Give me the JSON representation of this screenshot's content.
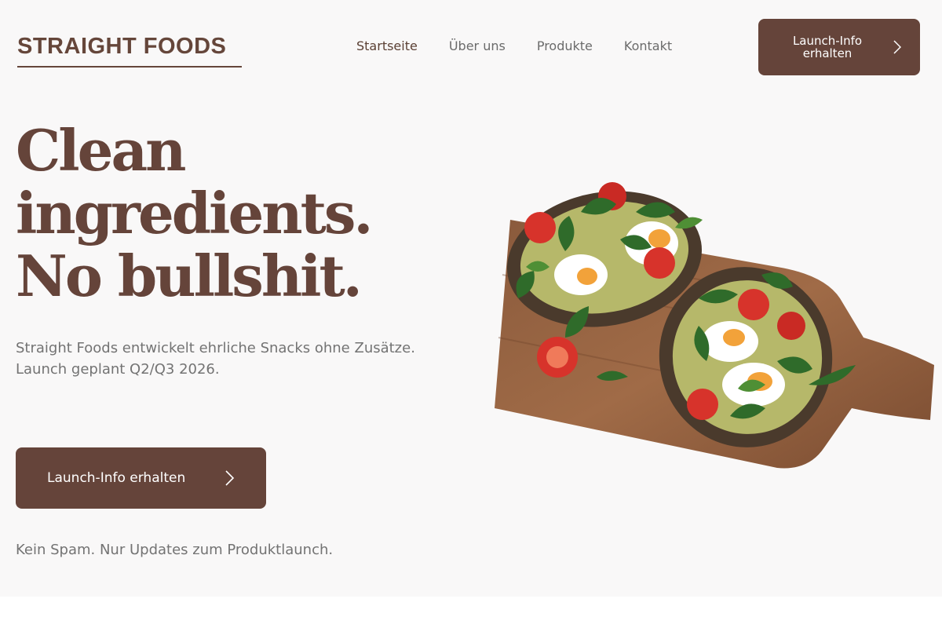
{
  "brand": {
    "name": "STRAIGHT FOODS"
  },
  "nav": {
    "items": [
      {
        "label": "Startseite",
        "active": true
      },
      {
        "label": "Über uns",
        "active": false
      },
      {
        "label": "Produkte",
        "active": false
      },
      {
        "label": "Kontakt",
        "active": false
      }
    ]
  },
  "header": {
    "cta": {
      "line1": "Launch-Info",
      "line2": "erhalten",
      "icon": "chevron-right-icon"
    }
  },
  "hero": {
    "headline": [
      "Clean",
      "ingredients.",
      "No bullshit."
    ],
    "subtext": [
      "Straight Foods entwickelt ehrliche Snacks ohne Zusätze.",
      "Launch geplant Q2/Q3 2026."
    ],
    "cta": {
      "label": "Launch-Info erhalten",
      "icon": "chevron-right-icon"
    },
    "note": "Kein Spam. Nur Updates zum Produktlaunch.",
    "image": {
      "subject": "avocado-egg-toast-on-wooden-board"
    }
  },
  "colors": {
    "brand_brown": "#65443a",
    "page_background": "#f9f8f8",
    "text_gray": "#737373"
  }
}
